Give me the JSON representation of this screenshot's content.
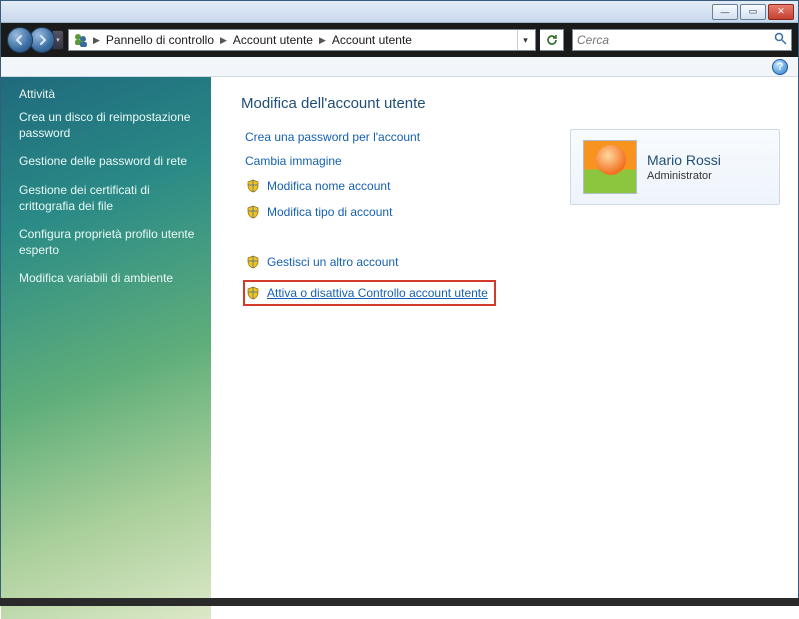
{
  "titlebar": {
    "min": "—",
    "max": "▭",
    "close": "✕"
  },
  "breadcrumbs": {
    "item1": "Pannello di controllo",
    "item2": "Account utente",
    "item3": "Account utente"
  },
  "search": {
    "placeholder": "Cerca"
  },
  "sidebar": {
    "heading": "Attività",
    "tasks": [
      "Crea un disco di reimpostazione password",
      "Gestione delle password di rete",
      "Gestione dei certificati di crittografia dei file",
      "Configura proprietà profilo utente esperto",
      "Modifica variabili di ambiente"
    ]
  },
  "main": {
    "title": "Modifica dell'account utente",
    "links": {
      "create_password": "Crea una password per l'account",
      "change_picture": "Cambia immagine",
      "change_name": "Modifica nome account",
      "change_type": "Modifica tipo di account",
      "manage_other": "Gestisci un altro account",
      "toggle_uac": "Attiva o disattiva Controllo account utente"
    }
  },
  "user": {
    "name": "Mario Rossi",
    "role": "Administrator"
  },
  "help_glyph": "?"
}
